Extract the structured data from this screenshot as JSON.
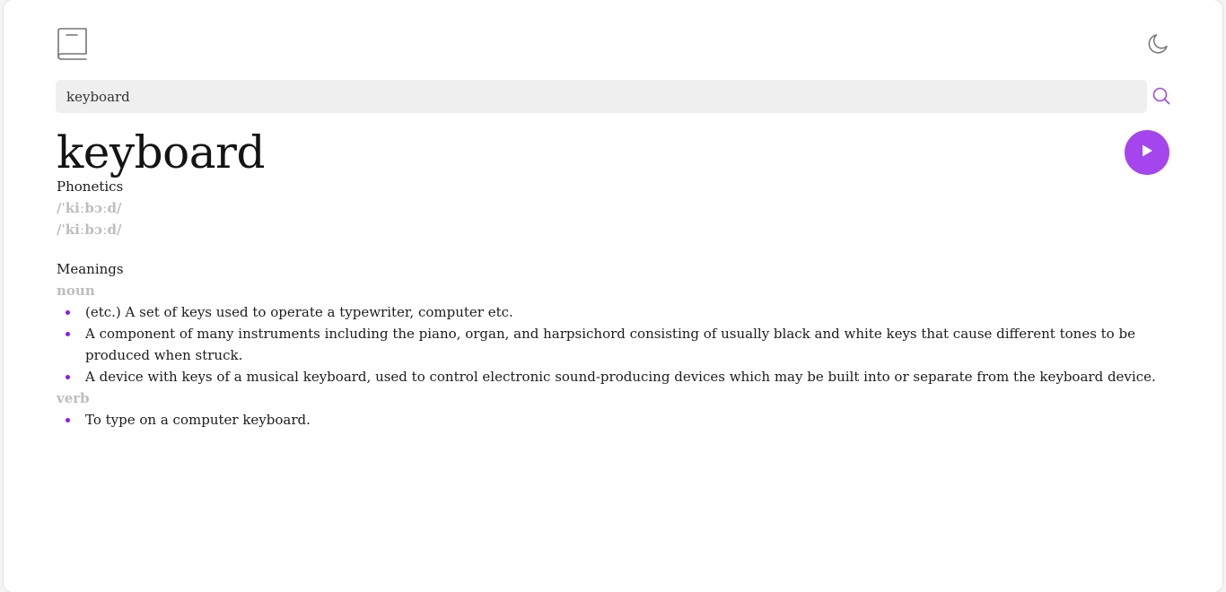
{
  "header": {
    "logo_icon": "book-icon",
    "theme_icon": "moon-icon"
  },
  "search": {
    "value": "keyboard",
    "placeholder": "",
    "icon": "search-icon",
    "accent_color": "#a445ed"
  },
  "entry": {
    "word": "keyboard",
    "play_icon": "play-icon",
    "play_color": "#a445ed"
  },
  "phonetics": {
    "title": "Phonetics",
    "items": [
      "/ˈkiːbɔːd/",
      "/ˈkiːbɔːd/"
    ]
  },
  "meanings": {
    "title": "Meanings",
    "groups": [
      {
        "part_of_speech": "noun",
        "definitions": [
          "(etc.) A set of keys used to operate a typewriter, computer etc.",
          "A component of many instruments including the piano, organ, and harpsichord consisting of usually black and white keys that cause different tones to be produced when struck.",
          "A device with keys of a musical keyboard, used to control electronic sound-producing devices which may be built into or separate from the keyboard device."
        ]
      },
      {
        "part_of_speech": "verb",
        "definitions": [
          "To type on a computer keyboard."
        ]
      }
    ]
  }
}
